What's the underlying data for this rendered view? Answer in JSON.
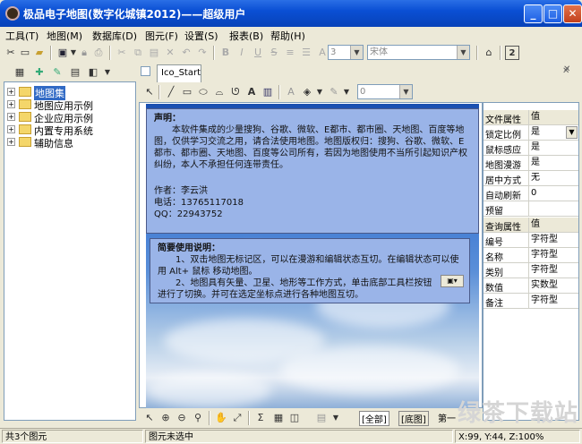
{
  "window": {
    "title": "极品电子地图(数字化城镇2012)——超级用户",
    "minimize": "_",
    "maximize": "□",
    "close": "✕"
  },
  "menu": [
    "工具(T)",
    "地图(M)",
    "数据库(D)",
    "图元(F)",
    "设置(S)",
    "报表(B)",
    "帮助(H)"
  ],
  "toolbar": {
    "layer_value": "3",
    "font_value": "宋体",
    "help_badge": "2"
  },
  "drawbar": {
    "size_value": "0"
  },
  "tree": [
    {
      "label": "地图集",
      "selected": true
    },
    {
      "label": "地图应用示例"
    },
    {
      "label": "企业应用示例"
    },
    {
      "label": "内置专用系统"
    },
    {
      "label": "辅助信息"
    }
  ],
  "tabs": {
    "map_tab": "Ico_Start",
    "close": "✕"
  },
  "note1": {
    "title": "声明：",
    "body": "本软件集成的少量搜狗、谷歌、微软、E都市、都市圈、天地图、百度等地图，仅供学习交流之用，请合法使用地图。地图版权归：搜狗、谷歌、微软、E都市、都市圈、天地图、百度等公司所有，若因为地图使用不当所引起知识产权纠纷，本人不承担任何连带责任。",
    "author": "作者：李云洪",
    "phone": "电话：13765117018",
    "qq": "QQ：22943752"
  },
  "note2": {
    "title": "简要使用说明：",
    "item1": "1、双击地图无标记区，可以在漫游和编辑状态互切。在编辑状态可以使用 Alt+ 鼠标 移动地图。",
    "item2": "2、地图具有矢量、卫星、地形等工作方式，单击底部工具栏按钮进行了切换。并可在选定坐标点进行各种地图互切。"
  },
  "props": {
    "section1": {
      "key": "文件属性",
      "val": "值"
    },
    "rows1": [
      {
        "k": "锁定比例",
        "v": "是"
      },
      {
        "k": "鼠标感应",
        "v": "是"
      },
      {
        "k": "地图漫游",
        "v": "是"
      },
      {
        "k": "居中方式",
        "v": "无"
      },
      {
        "k": "自动刷新",
        "v": "0"
      },
      {
        "k": "预留",
        "v": ""
      }
    ],
    "section2": {
      "key": "查询属性",
      "val": "值"
    },
    "rows2": [
      {
        "k": "编号",
        "v": "字符型"
      },
      {
        "k": "名称",
        "v": "字符型"
      },
      {
        "k": "类别",
        "v": "字符型"
      },
      {
        "k": "数值",
        "v": "实数型"
      },
      {
        "k": "备注",
        "v": "字符型"
      }
    ]
  },
  "bottom_tabs": [
    "全部",
    "底图",
    "第一"
  ],
  "status": {
    "count": "共3个图元",
    "selection": "图元未选中",
    "coords": "X:99, Y:44, Z:100%"
  },
  "watermark": "绿茶下载站"
}
